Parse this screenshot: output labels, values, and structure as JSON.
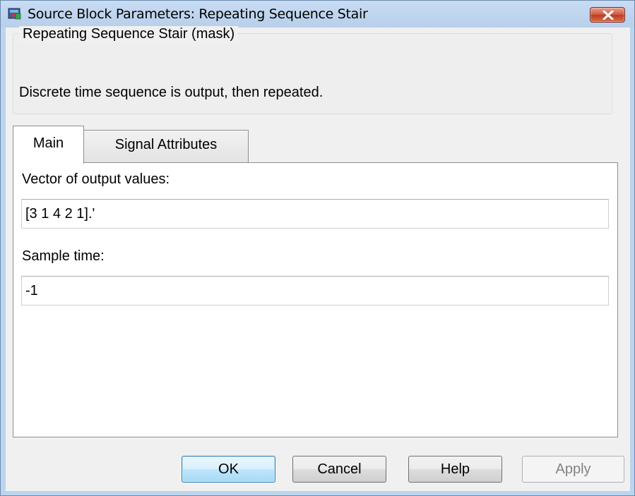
{
  "window": {
    "title": "Source Block Parameters: Repeating Sequence Stair"
  },
  "mask": {
    "title": "Repeating Sequence Stair (mask)",
    "description": "Discrete time sequence is output, then repeated."
  },
  "tabs": [
    {
      "label": "Main",
      "selected": true
    },
    {
      "label": "Signal Attributes",
      "selected": false
    }
  ],
  "parameters": {
    "output_values_label": "Vector of output values:",
    "output_values_value": "[3 1 4 2 1].'",
    "sample_time_label": "Sample time:",
    "sample_time_value": "-1"
  },
  "buttons": {
    "ok": "OK",
    "cancel": "Cancel",
    "help": "Help",
    "apply": "Apply"
  },
  "icons": {
    "app": "simulink-block-icon",
    "close": "close-icon"
  },
  "colors": {
    "titlebar": "#bcd4ee",
    "close_button": "#c94a30",
    "dialog_background": "#f0f0f0",
    "ok_button": "#bee6fd"
  }
}
